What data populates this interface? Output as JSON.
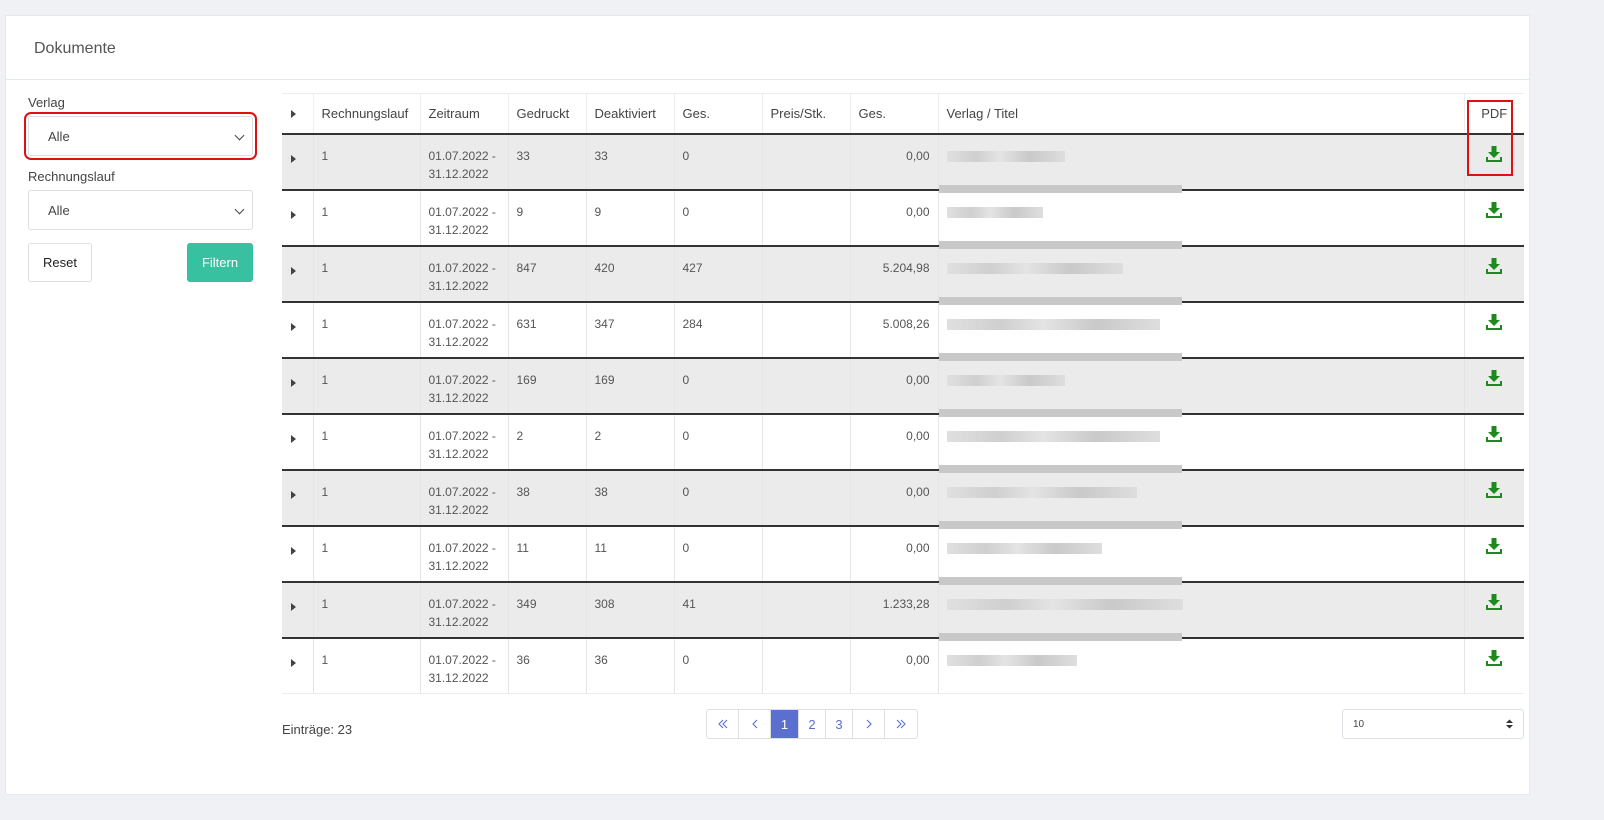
{
  "card": {
    "title": "Dokumente"
  },
  "filters": {
    "verlag_label": "Verlag",
    "verlag_value": "Alle",
    "rechnungslauf_label": "Rechnungslauf",
    "rechnungslauf_value": "Alle",
    "reset_label": "Reset",
    "filter_label": "Filtern"
  },
  "table": {
    "columns": [
      "Rechnungslauf",
      "Zeitraum",
      "Gedruckt",
      "Deaktiviert",
      "Ges.",
      "Preis/Stk.",
      "Ges.",
      "Verlag / Titel",
      "PDF"
    ],
    "rows": [
      {
        "rl": "1",
        "z1": "01.07.2022 -",
        "z2": "31.12.2022",
        "gd": "33",
        "dk": "33",
        "ges": "0",
        "ps": "",
        "tot": "0,00"
      },
      {
        "rl": "1",
        "z1": "01.07.2022 -",
        "z2": "31.12.2022",
        "gd": "9",
        "dk": "9",
        "ges": "0",
        "ps": "",
        "tot": "0,00"
      },
      {
        "rl": "1",
        "z1": "01.07.2022 -",
        "z2": "31.12.2022",
        "gd": "847",
        "dk": "420",
        "ges": "427",
        "ps": "",
        "tot": "5.204,98"
      },
      {
        "rl": "1",
        "z1": "01.07.2022 -",
        "z2": "31.12.2022",
        "gd": "631",
        "dk": "347",
        "ges": "284",
        "ps": "",
        "tot": "5.008,26"
      },
      {
        "rl": "1",
        "z1": "01.07.2022 -",
        "z2": "31.12.2022",
        "gd": "169",
        "dk": "169",
        "ges": "0",
        "ps": "",
        "tot": "0,00"
      },
      {
        "rl": "1",
        "z1": "01.07.2022 -",
        "z2": "31.12.2022",
        "gd": "2",
        "dk": "2",
        "ges": "0",
        "ps": "",
        "tot": "0,00"
      },
      {
        "rl": "1",
        "z1": "01.07.2022 -",
        "z2": "31.12.2022",
        "gd": "38",
        "dk": "38",
        "ges": "0",
        "ps": "",
        "tot": "0,00"
      },
      {
        "rl": "1",
        "z1": "01.07.2022 -",
        "z2": "31.12.2022",
        "gd": "11",
        "dk": "11",
        "ges": "0",
        "ps": "",
        "tot": "0,00"
      },
      {
        "rl": "1",
        "z1": "01.07.2022 -",
        "z2": "31.12.2022",
        "gd": "349",
        "dk": "308",
        "ges": "41",
        "ps": "",
        "tot": "1.233,28"
      },
      {
        "rl": "1",
        "z1": "01.07.2022 -",
        "z2": "31.12.2022",
        "gd": "36",
        "dk": "36",
        "ges": "0",
        "ps": "",
        "tot": "0,00"
      }
    ]
  },
  "footer": {
    "entries": "Einträge: 23",
    "pages": [
      "1",
      "2",
      "3"
    ],
    "per_page": "10"
  },
  "colors": {
    "accent": "#5b6fd1",
    "filter_button": "#38c1a1",
    "download_icon": "#1e8a1e",
    "highlight": "#e01010"
  },
  "icons": {
    "download": "download-icon",
    "expand": "caret-right-icon"
  }
}
